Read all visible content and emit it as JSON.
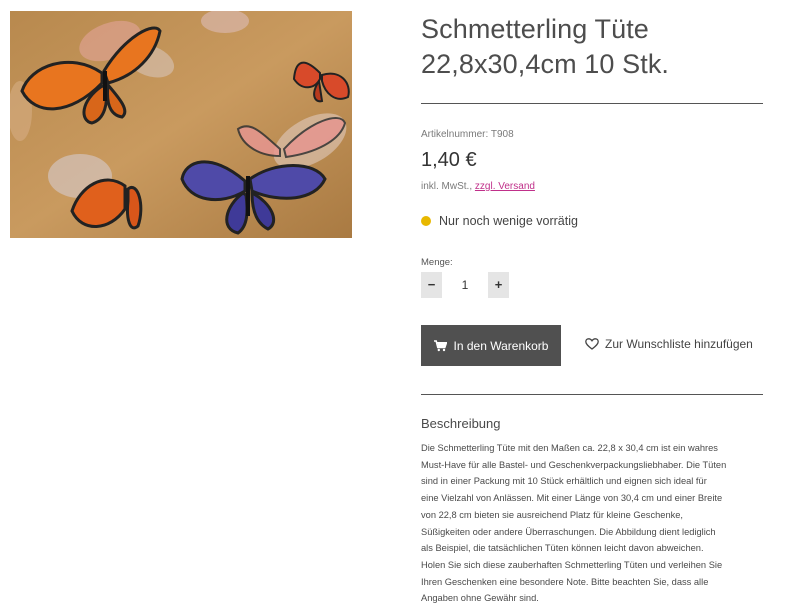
{
  "product": {
    "title_line1": "Schmetterling Tüte",
    "title_line2": "22,8x30,4cm 10 Stk.",
    "sku_label": "Artikelnummer:",
    "sku": "T908",
    "price": "1,40 €",
    "tax_text": "inkl. MwSt.,",
    "shipping_link": "zzgl. Versand",
    "stock_text": "Nur noch wenige vorrätig",
    "stock_color": "#e8b800"
  },
  "quantity": {
    "label": "Menge:",
    "value": "1",
    "decrement": "−",
    "increment": "+"
  },
  "actions": {
    "cart_label": "In den Warenkorb",
    "wishlist_label": "Zur Wunschliste hinzufügen"
  },
  "description": {
    "heading": "Beschreibung",
    "lines": [
      "Die Schmetterling Tüte mit den Maßen ca. 22,8 x 30,4 cm ist ein wahres",
      "Must-Have für alle Bastel- und Geschenkverpackungsliebhaber. Die Tüten",
      "sind in einer Packung mit 10 Stück erhältlich und eignen sich ideal für",
      "eine Vielzahl von Anlässen. Mit einer Länge von 30,4 cm und einer Breite",
      "von 22,8 cm bieten sie ausreichend Platz für kleine Geschenke,",
      "Süßigkeiten oder andere Überraschungen. Die Abbildung dient lediglich",
      "als Beispiel, die tatsächlichen Tüten können leicht davon abweichen.",
      "Holen Sie sich diese zauberhaften Schmetterling Tüten und verleihen Sie",
      "Ihren Geschenken eine besondere Note. Bitte beachten Sie, dass alle",
      "Angaben ohne Gewähr sind."
    ]
  },
  "colors": {
    "cart_button": "#505050",
    "link": "#c0308a"
  }
}
